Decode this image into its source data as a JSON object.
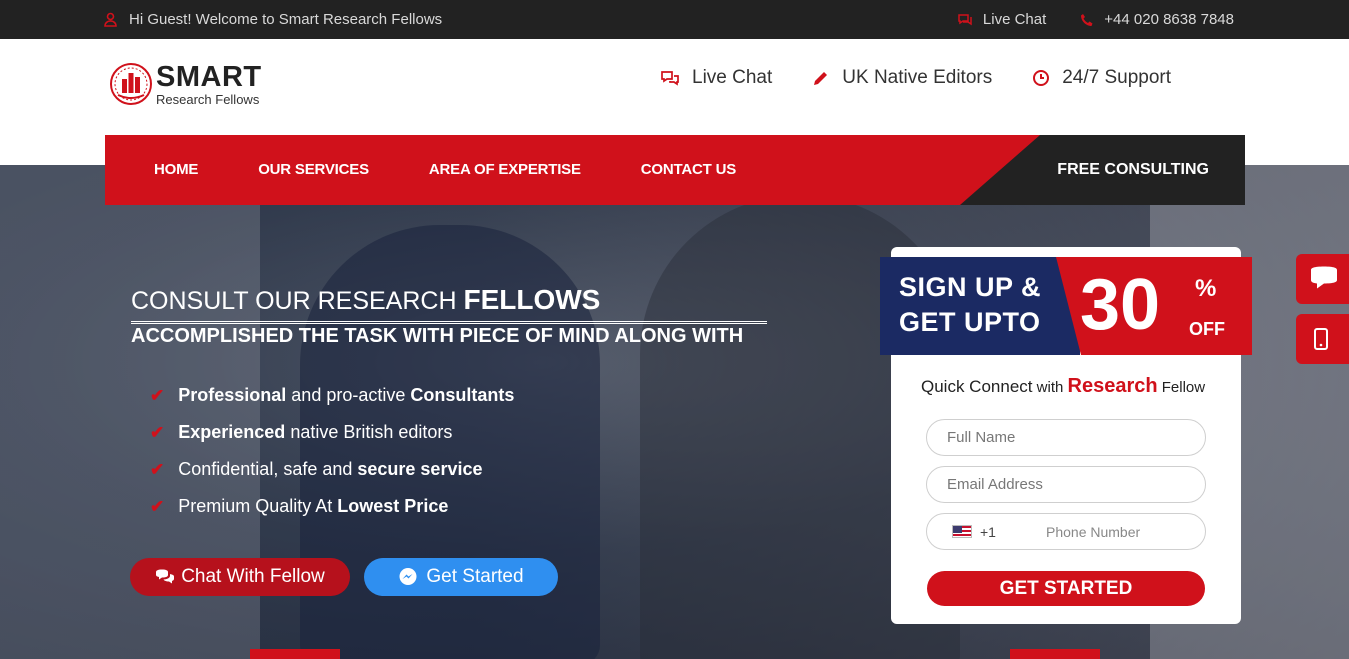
{
  "topbar": {
    "welcome": "Hi Guest! Welcome to Smart Research Fellows",
    "live_chat": "Live Chat",
    "phone": "+44 020 8638 7848",
    "icons": [
      "user-icon",
      "chat-icon",
      "phone-icon"
    ]
  },
  "logo": {
    "title": "SMART",
    "subtitle": "Research Fellows"
  },
  "features": [
    {
      "label": "Live Chat",
      "icon": "chat-bubbles-icon"
    },
    {
      "label": "UK Native Editors",
      "icon": "pencil-icon"
    },
    {
      "label": "24/7 Support",
      "icon": "clock-icon"
    }
  ],
  "nav": {
    "items": [
      "HOME",
      "OUR SERVICES",
      "AREA OF EXPERTISE",
      "CONTACT US"
    ],
    "cta": "FREE CONSULTING"
  },
  "hero": {
    "title_prefix": "CONSULT OUR RESEARCH ",
    "title_bold": "FELLOWS",
    "subtitle": "ACCOMPLISHED THE TASK WITH PIECE OF MIND ALONG WITH",
    "points": [
      {
        "a": "Professional",
        "b": " and pro-active ",
        "c": "Consultants"
      },
      {
        "a": "Experienced",
        "b": " native British editors",
        "c": ""
      },
      {
        "a": "",
        "b": "Confidential, safe and ",
        "c": "secure service"
      },
      {
        "a": "",
        "b": "Premium Quality At ",
        "c": "Lowest Price"
      }
    ],
    "chat_button": "Chat With Fellow",
    "start_button": "Get Started"
  },
  "promo": {
    "line1": "SIGN UP &",
    "line2": "GET UPTO",
    "number": "30",
    "percent": "%",
    "off": "OFF"
  },
  "form": {
    "heading_a": "Quick Connect",
    "heading_b": " with ",
    "heading_c": "Research",
    "heading_d": " Fellow",
    "name_placeholder": "Full Name",
    "email_placeholder": "Email Address",
    "country_code": "+1",
    "phone_placeholder": "Phone Number",
    "submit": "GET STARTED"
  },
  "colors": {
    "brand_red": "#d0111b",
    "dark": "#222222",
    "navy": "#1b2a63",
    "blue": "#2f8ff0"
  }
}
